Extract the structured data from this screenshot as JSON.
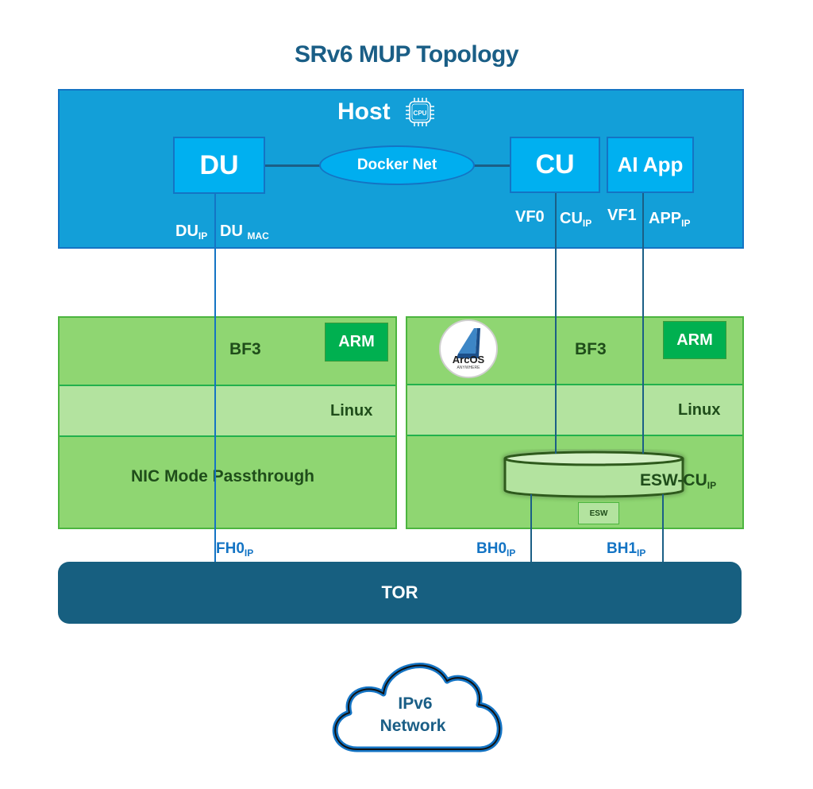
{
  "title": "SRv6 MUP Topology",
  "host": {
    "label": "Host",
    "cpu_icon_label": "CPU",
    "du": {
      "label": "DU",
      "ip_label": "DU",
      "ip_sub": "IP",
      "mac_label": "DU",
      "mac_sub": "MAC"
    },
    "docker_net": {
      "label": "Docker Net"
    },
    "cu": {
      "label": "CU",
      "vf_label": "VF0",
      "ip_label": "CU",
      "ip_sub": "IP"
    },
    "ai_app": {
      "label": "AI App",
      "vf_label": "VF1",
      "ip_label": "APP",
      "ip_sub": "IP"
    }
  },
  "bf3_left": {
    "label": "BF3",
    "arm_label": "ARM",
    "linux_label": "Linux",
    "mode_label": "NIC Mode Passthrough",
    "port_label": "FH0",
    "port_sub": "IP"
  },
  "bf3_right": {
    "label": "BF3",
    "arm_label": "ARM",
    "linux_label": "Linux",
    "logo": {
      "name": "ArcOS",
      "tagline": "ANYWHERE"
    },
    "esw_cu_label": "ESW-CU",
    "esw_cu_sub": "IP",
    "esw_label": "ESW",
    "port0_label": "BH0",
    "port0_sub": "IP",
    "port1_label": "BH1",
    "port1_sub": "IP"
  },
  "tor": {
    "label": "TOR"
  },
  "cloud": {
    "line1": "IPv6",
    "line2": "Network"
  },
  "colors": {
    "title": "#1a5e86",
    "host_bg": "#139fd8",
    "box_bg": "#00b0f0",
    "bf3_bg": "#8fd672",
    "linux_bg": "#b3e39f",
    "arm_bg": "#00b050",
    "tor_bg": "#175f80",
    "link_blue": "#1474c4"
  }
}
